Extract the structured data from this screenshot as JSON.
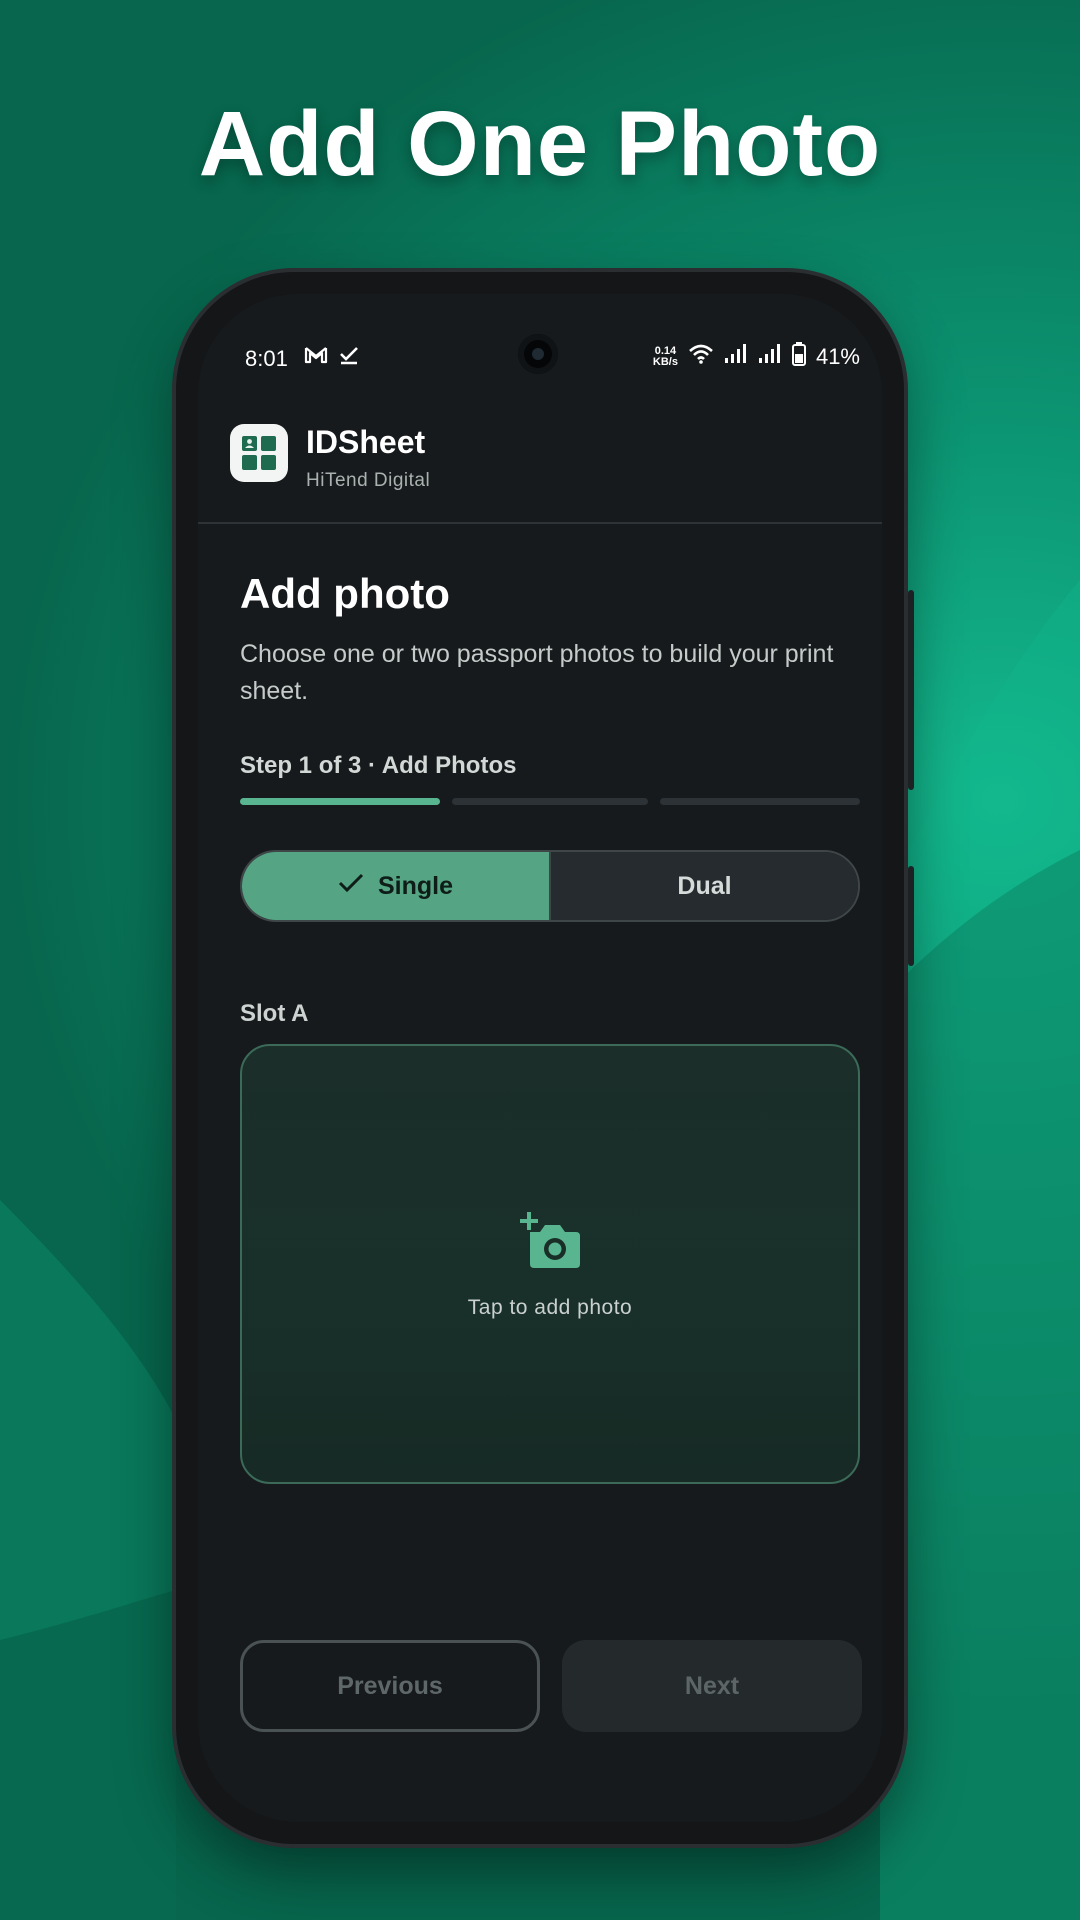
{
  "hero": {
    "title": "Add One Photo"
  },
  "status_bar": {
    "time": "8:01",
    "net_speed_value": "0.14",
    "net_speed_unit": "KB/s",
    "battery": "41%",
    "left_icons": [
      "gmail-icon",
      "task-done-icon"
    ],
    "right_icons": [
      "wifi-icon",
      "signal-icon",
      "signal-icon",
      "battery-icon"
    ]
  },
  "app": {
    "name": "IDSheet",
    "developer": "HiTend Digital",
    "icon": "idsheet-logo-icon"
  },
  "page": {
    "title": "Add photo",
    "description": "Choose one or two passport photos to build your print sheet.",
    "step_label": "Step 1 of 3 · Add Photos",
    "step_current": 1,
    "step_total": 3
  },
  "mode_toggle": {
    "selected": "Single",
    "options": [
      {
        "label": "Single",
        "icon": "check-icon"
      },
      {
        "label": "Dual"
      }
    ]
  },
  "slot": {
    "label": "Slot A",
    "placeholder": "Tap to add photo",
    "icon": "add-photo-camera-icon"
  },
  "navigation": {
    "previous": "Previous",
    "next": "Next"
  },
  "colors": {
    "accent": "#58b590",
    "background_top": "#0c9673",
    "screen": "#161a1c"
  }
}
